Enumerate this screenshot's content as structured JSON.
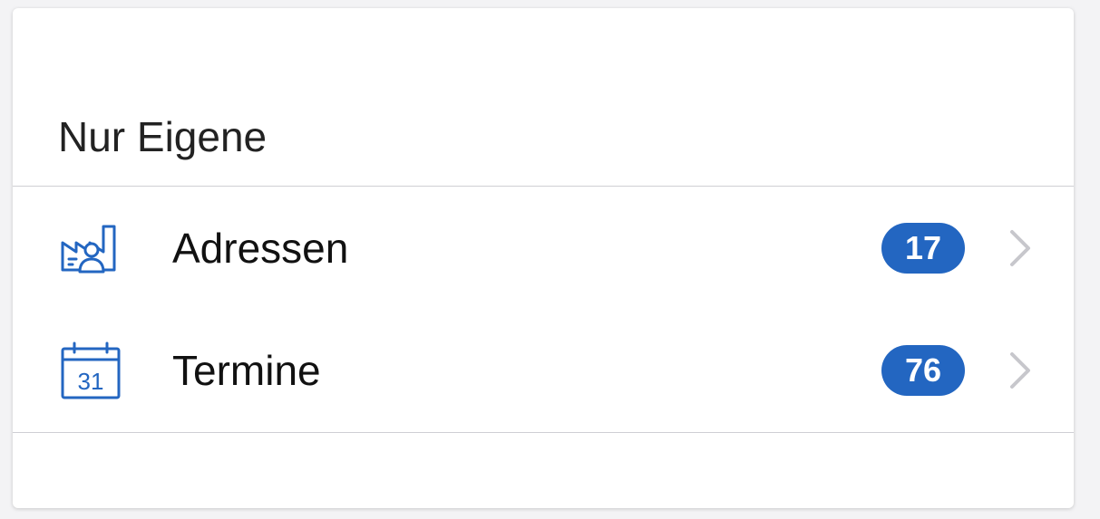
{
  "section": {
    "title": "Nur Eigene"
  },
  "items": [
    {
      "label": "Adressen",
      "count": "17",
      "icon": "factory-person-icon"
    },
    {
      "label": "Termine",
      "count": "76",
      "icon": "calendar-icon"
    }
  ],
  "calendar_icon_day": "31",
  "colors": {
    "accent": "#2366c1",
    "chevron": "#c7c7cc",
    "divider": "#cfcfd4"
  }
}
